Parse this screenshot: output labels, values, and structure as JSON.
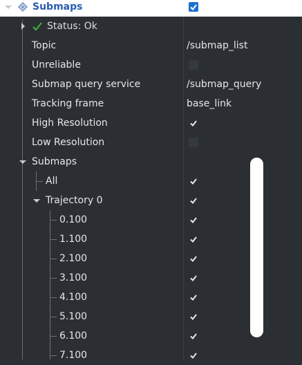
{
  "display": {
    "name": "Submaps",
    "enabled": true,
    "status": {
      "label": "Status: Ok"
    }
  },
  "properties": [
    {
      "label": "Topic",
      "value": "/submap_list"
    },
    {
      "label": "Unreliable",
      "checked": false
    },
    {
      "label": "Submap query service",
      "value": "/submap_query"
    },
    {
      "label": "Tracking frame",
      "value": "base_link"
    },
    {
      "label": "High Resolution",
      "checked": true
    },
    {
      "label": "Low Resolution",
      "checked": false
    }
  ],
  "submaps_group": {
    "label": "Submaps",
    "all": {
      "label": "All",
      "checked": true
    },
    "trajectory": {
      "label": "Trajectory 0",
      "checked": true,
      "items": [
        "0.100",
        "1.100",
        "2.100",
        "3.100",
        "4.100",
        "5.100",
        "6.100",
        "7.100"
      ]
    }
  }
}
